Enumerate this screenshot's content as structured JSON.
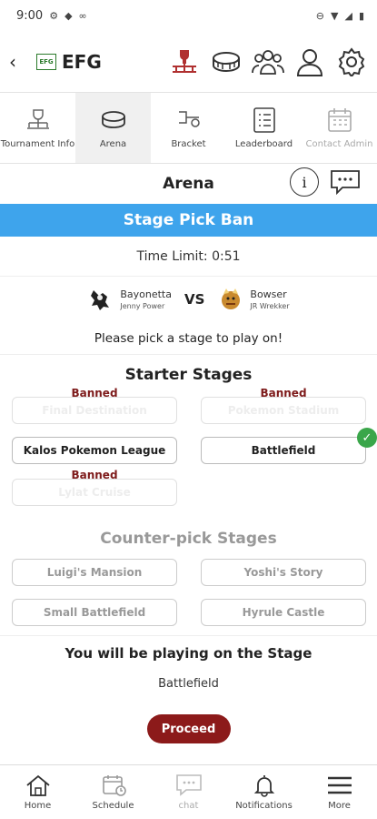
{
  "status_bar": {
    "time": "9:00"
  },
  "header": {
    "logo_text": "EFG",
    "title": "EFG"
  },
  "tabs": [
    {
      "label": "Tournament Info"
    },
    {
      "label": "Arena"
    },
    {
      "label": "Bracket"
    },
    {
      "label": "Leaderboard"
    },
    {
      "label": "Contact Admin"
    }
  ],
  "page": {
    "title": "Arena",
    "info_icon": "i"
  },
  "banner": {
    "title": "Stage Pick Ban"
  },
  "time_limit": "Time Limit: 0:51",
  "match": {
    "player1": {
      "character": "Bayonetta",
      "name": "Jenny Power"
    },
    "vs": "VS",
    "player2": {
      "character": "Bowser",
      "name": "JR Wrekker"
    }
  },
  "instruction": "Please pick a stage to play on!",
  "starter": {
    "title": "Starter Stages",
    "banned_label": "Banned",
    "stages": [
      {
        "name": "Final Destination",
        "status": "banned"
      },
      {
        "name": "Pokemon Stadium",
        "status": "banned"
      },
      {
        "name": "Kalos Pokemon League",
        "status": "available"
      },
      {
        "name": "Battlefield",
        "status": "selected"
      },
      {
        "name": "Lylat Cruise",
        "status": "banned"
      }
    ]
  },
  "counterpick": {
    "title": "Counter-pick Stages",
    "stages": [
      {
        "name": "Luigi's Mansion"
      },
      {
        "name": "Yoshi's Story"
      },
      {
        "name": "Small Battlefield"
      },
      {
        "name": "Hyrule Castle"
      }
    ]
  },
  "result": {
    "title": "You will be playing on the Stage",
    "stage": "Battlefield"
  },
  "proceed_label": "Proceed",
  "bottom_nav": [
    {
      "label": "Home"
    },
    {
      "label": "Schedule"
    },
    {
      "label": "chat"
    },
    {
      "label": "Notifications"
    },
    {
      "label": "More"
    }
  ],
  "colors": {
    "banner": "#3ea4ec",
    "banned": "#7d1a1a",
    "proceed": "#8c1a1a",
    "check": "#3aa64a"
  }
}
